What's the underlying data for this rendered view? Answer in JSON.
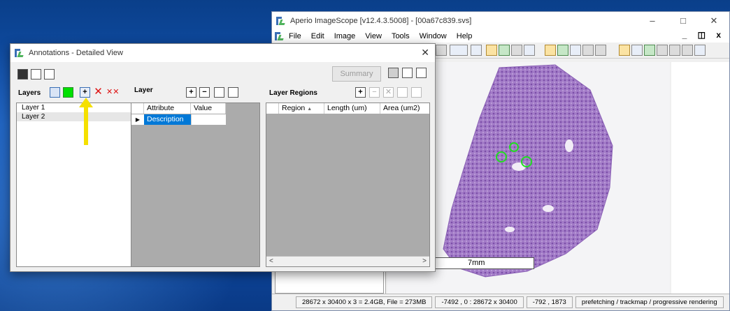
{
  "main_window": {
    "title": "Aperio ImageScope [v12.4.3.5008] - [00a67c839.svs]",
    "menu": [
      "File",
      "Edit",
      "Image",
      "View",
      "Tools",
      "Window",
      "Help"
    ],
    "scale_label": "7mm",
    "status": [
      "28672 x 30400 x 3 = 2.4GB, File = 273MB",
      "-7492 , 0 : 28672 x 30400",
      "-792 , 1873",
      "prefetching / trackmap / progressive rendering"
    ]
  },
  "annotations": {
    "title": "Annotations - Detailed View",
    "summary_label": "Summary",
    "layers_header": "Layers",
    "layer_header": "Layer",
    "regions_header": "Layer Regions",
    "layers": [
      "Layer 1",
      "Layer 2"
    ],
    "attr_cols": [
      "Attribute",
      "Value"
    ],
    "attr_rows": [
      {
        "attribute": "Description",
        "value": ""
      }
    ],
    "region_cols": [
      "Region",
      "Length (um)",
      "Area (um2)"
    ]
  },
  "colors": {
    "layer_color_swatch": "#00e000",
    "highlight_arrow": "#f5e000",
    "annotation_circle": "#22dd22",
    "tissue": "#9a6cc0"
  },
  "icons": {
    "arrow": "up-arrow-icon",
    "add_layer": "plus-icon",
    "delete_layer": "x-icon",
    "delete_all": "double-x-icon"
  }
}
